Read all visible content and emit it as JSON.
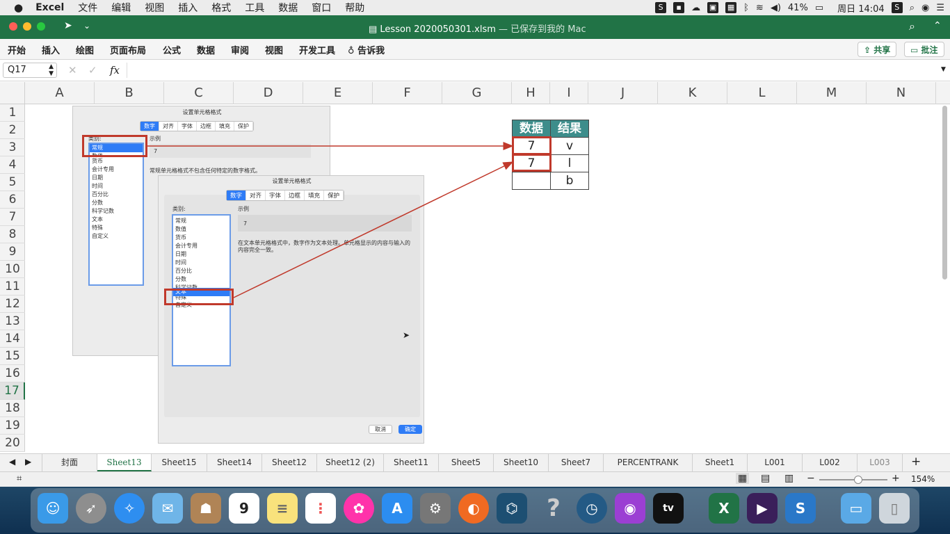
{
  "menubar": {
    "app": "Excel",
    "items": [
      "文件",
      "编辑",
      "视图",
      "插入",
      "格式",
      "工具",
      "数据",
      "窗口",
      "帮助"
    ],
    "battery": "41%",
    "clock": "周日 14:04"
  },
  "window": {
    "title": "Lesson 2020050301.xlsm",
    "saved_status": "— 已保存到我的 Mac"
  },
  "ribbon": {
    "tabs": [
      "开始",
      "插入",
      "绘图",
      "页面布局",
      "公式",
      "数据",
      "审阅",
      "视图",
      "开发工具"
    ],
    "tell_me": "告诉我",
    "share": "共享",
    "comment": "批注"
  },
  "formula_bar": {
    "cell_ref": "Q17",
    "fx": "fx",
    "value": ""
  },
  "grid": {
    "columns": [
      "A",
      "B",
      "C",
      "D",
      "E",
      "F",
      "G",
      "H",
      "I",
      "J",
      "K",
      "L",
      "M",
      "N"
    ],
    "rows": [
      "1",
      "2",
      "3",
      "4",
      "5",
      "6",
      "7",
      "8",
      "9",
      "10",
      "11",
      "12",
      "13",
      "14",
      "15",
      "16",
      "17",
      "18",
      "19",
      "20"
    ],
    "selected_row": "17"
  },
  "table": {
    "headers": [
      "数据",
      "结果"
    ],
    "rows": [
      [
        "7",
        "v"
      ],
      [
        "7",
        "l"
      ],
      [
        "",
        "b"
      ]
    ]
  },
  "dialog1": {
    "title": "设置单元格格式",
    "tabs": [
      "数字",
      "对齐",
      "字体",
      "边框",
      "填充",
      "保护"
    ],
    "category_label": "类别:",
    "categories": [
      "常规",
      "数值",
      "货币",
      "会计专用",
      "日期",
      "时间",
      "百分比",
      "分数",
      "科学记数",
      "文本",
      "特殊",
      "自定义"
    ],
    "selected": "常规",
    "sample_label": "示例",
    "sample_value": "7",
    "description": "常规单元格格式不包含任何特定的数字格式。"
  },
  "dialog2": {
    "title": "设置单元格格式",
    "tabs": [
      "数字",
      "对齐",
      "字体",
      "边框",
      "填充",
      "保护"
    ],
    "category_label": "类别:",
    "categories": [
      "常规",
      "数值",
      "货币",
      "会计专用",
      "日期",
      "时间",
      "百分比",
      "分数",
      "科学记数",
      "文本",
      "特殊",
      "自定义"
    ],
    "selected": "文本",
    "sample_label": "示例",
    "sample_value": "7",
    "description": "在文本单元格格式中，数字作为文本处理。单元格显示的内容与输入的内容完全一致。",
    "cancel": "取消",
    "ok": "确定"
  },
  "sheet_tabs": [
    "封面",
    "Sheet13",
    "Sheet15",
    "Sheet14",
    "Sheet12",
    "Sheet12 (2)",
    "Sheet11",
    "Sheet5",
    "Sheet10",
    "Sheet7",
    "PERCENTRANK",
    "Sheet1",
    "L001",
    "L002",
    "L003"
  ],
  "active_sheet": "Sheet13",
  "status": {
    "zoom": "154%"
  },
  "colors": {
    "excel_green": "#217346",
    "header_teal": "#3d8d8b",
    "annotation_red": "#c0392b",
    "selection_blue": "#2f7cf6"
  }
}
